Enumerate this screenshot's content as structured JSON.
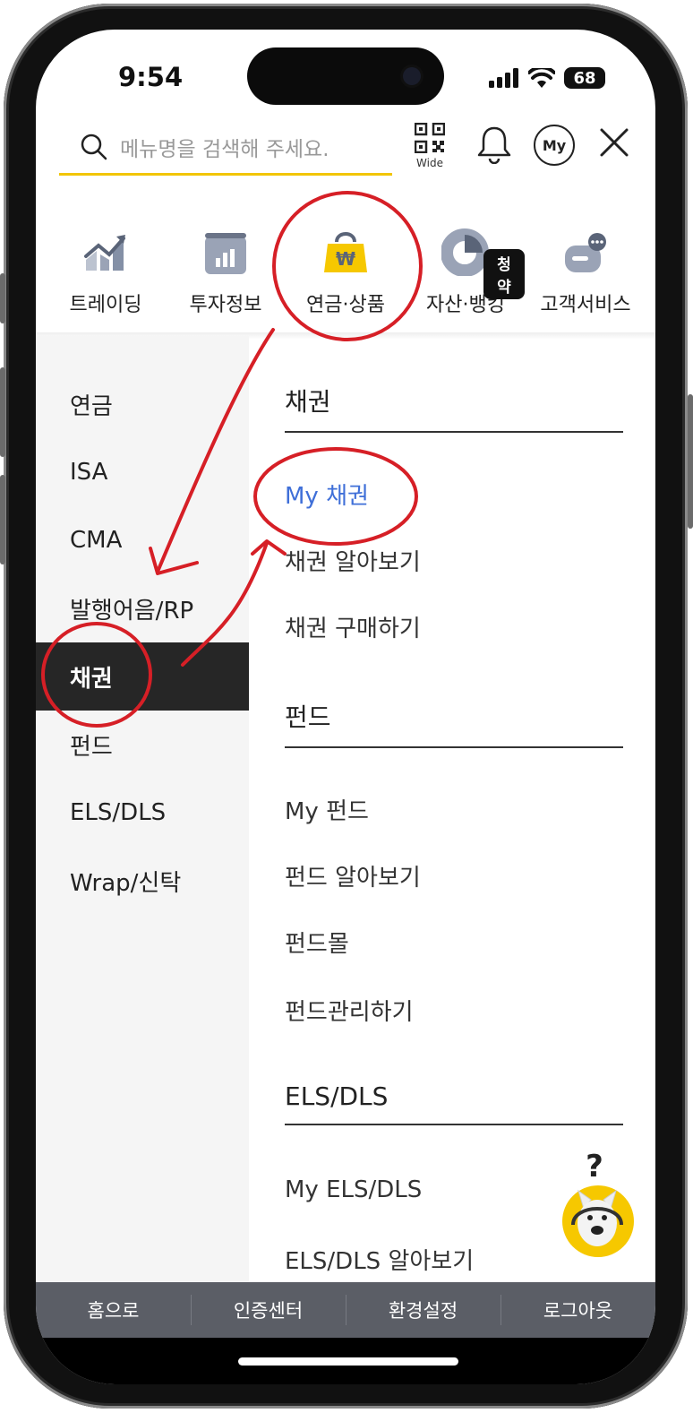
{
  "status_bar": {
    "time": "9:54",
    "battery": "68"
  },
  "search": {
    "placeholder": "메뉴명을 검색해 주세요."
  },
  "header_actions": {
    "qr_label": "Wide",
    "my_label": "My"
  },
  "categories": [
    {
      "label": "트레이딩",
      "icon": "trading-chart-icon"
    },
    {
      "label": "투자정보",
      "icon": "info-chart-icon"
    },
    {
      "label": "연금·상품",
      "icon": "won-bag-icon"
    },
    {
      "label": "자산·뱅킹",
      "icon": "pie-chart-icon",
      "badge": "청약"
    },
    {
      "label": "고객서비스",
      "icon": "chat-card-icon"
    }
  ],
  "left_menu": [
    {
      "label": "연금"
    },
    {
      "label": "ISA"
    },
    {
      "label": "CMA"
    },
    {
      "label": "발행어음/RP"
    },
    {
      "label": "채권",
      "active": true
    },
    {
      "label": "펀드"
    },
    {
      "label": "ELS/DLS"
    },
    {
      "label": "Wrap/신탁"
    }
  ],
  "sections": [
    {
      "title": "채권",
      "items": [
        "My 채권",
        "채권 알아보기",
        "채권 구매하기"
      ]
    },
    {
      "title": "펀드",
      "items": [
        "My 펀드",
        "펀드 알아보기",
        "펀드몰",
        "펀드관리하기"
      ]
    },
    {
      "title": "ELS/DLS",
      "items": [
        "My ELS/DLS",
        "ELS/DLS 알아보기"
      ]
    }
  ],
  "bottom_bar": [
    "홈으로",
    "인증센터",
    "환경설정",
    "로그아웃"
  ],
  "colors": {
    "accent_yellow": "#f2c500",
    "highlight_blue": "#3f6fd8",
    "annotation_red": "#d61f26",
    "active_bg": "#262626",
    "bottom_bar": "#5b5e66"
  }
}
